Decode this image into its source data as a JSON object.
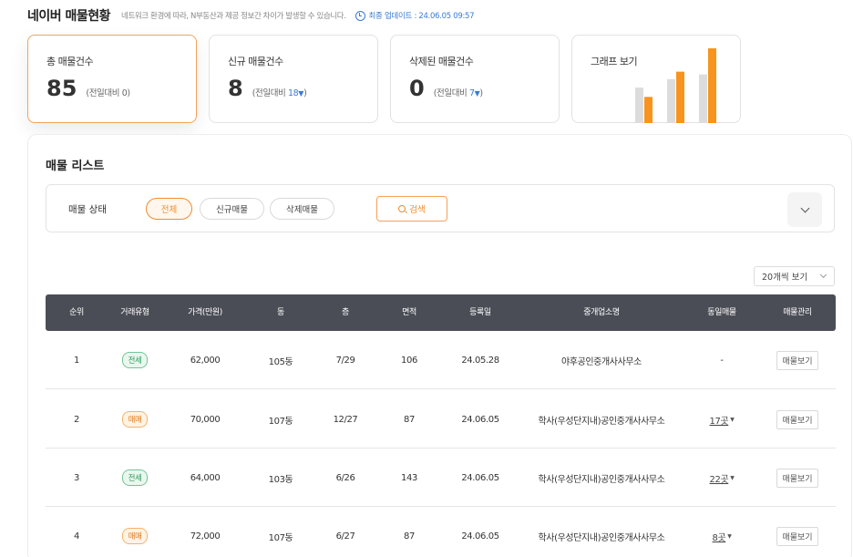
{
  "header": {
    "title": "네이버 매물현황",
    "notice": "네트워크 환경에 따라, N부동산과 제공 정보간 차이가 발생할 수 있습니다.",
    "update_text": "최종 업데이트 : 24.06.05 09:57"
  },
  "cards": {
    "total": {
      "label": "총 매물건수",
      "value": "85",
      "compare_prefix": "(전일대비 ",
      "compare_num": "0",
      "compare_suffix": ")"
    },
    "new": {
      "label": "신규 매물건수",
      "value": "8",
      "compare_prefix": "(전일대비 ",
      "compare_num": "18",
      "compare_suffix": ")"
    },
    "deleted": {
      "label": "삭제된 매물건수",
      "value": "0",
      "compare_prefix": "(전일대비 ",
      "compare_num": "7",
      "compare_suffix": ")"
    },
    "graph": {
      "label": "그래프 보기"
    }
  },
  "mini_chart": {
    "series_colors": [
      "#dcdcdc",
      "#f7941d"
    ],
    "groups": [
      {
        "gray": 38,
        "orange": 28
      },
      {
        "gray": 47,
        "orange": 55
      },
      {
        "gray": 52,
        "orange": 80
      }
    ]
  },
  "list": {
    "title": "매물 리스트",
    "filter_label": "매물 상태",
    "filters": [
      {
        "label": "전체",
        "active": true
      },
      {
        "label": "신규매물",
        "active": false
      },
      {
        "label": "삭제매물",
        "active": false
      }
    ],
    "search_label": "검색",
    "per_page": "20개씩 보기",
    "columns": [
      "순위",
      "거래유형",
      "가격(만원)",
      "동",
      "층",
      "면적",
      "등록일",
      "중개업소명",
      "동일매물",
      "매물관리"
    ],
    "view_label": "매물보기",
    "rows": [
      {
        "rank": "1",
        "type": "전세",
        "price": "62,000",
        "dong": "105동",
        "floor": "7/29",
        "area": "106",
        "date": "24.05.28",
        "agency": "야후공인중개사사무소",
        "same": "-"
      },
      {
        "rank": "2",
        "type": "매매",
        "price": "70,000",
        "dong": "107동",
        "floor": "12/27",
        "area": "87",
        "date": "24.06.05",
        "agency": "학사(우성단지내)공인중개사사무소",
        "same": "17곳"
      },
      {
        "rank": "3",
        "type": "전세",
        "price": "64,000",
        "dong": "103동",
        "floor": "6/26",
        "area": "143",
        "date": "24.06.05",
        "agency": "학사(우성단지내)공인중개사사무소",
        "same": "22곳"
      },
      {
        "rank": "4",
        "type": "매매",
        "price": "72,000",
        "dong": "107동",
        "floor": "6/27",
        "area": "87",
        "date": "24.06.05",
        "agency": "학사(우성단지내)공인중개사사무소",
        "same": "8곳"
      }
    ]
  }
}
